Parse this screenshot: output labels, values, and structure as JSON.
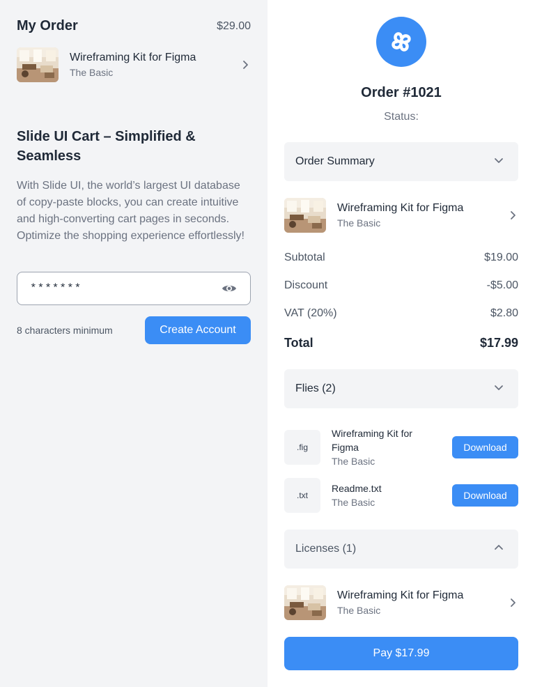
{
  "left": {
    "order_title": "My Order",
    "order_price": "$29.00",
    "product": {
      "name": "Wireframing Kit for Figma",
      "variant": "The Basic"
    },
    "promo_title": "Slide UI Cart – Simplified & Seamless",
    "promo_text": "With Slide UI, the world’s largest UI database of copy-paste blocks, you can create intuitive and high-converting cart pages in seconds. Optimize the shopping experience effortlessly!",
    "password_value": "*******",
    "password_hint": "8 characters minimum",
    "create_button": "Create Account"
  },
  "right": {
    "order_number": "Order #1021",
    "status_label": "Status:",
    "summary_title": "Order Summary",
    "summary_product": {
      "name": "Wireframing Kit for Figma",
      "variant": "The Basic"
    },
    "rows": [
      {
        "label": "Subtotal",
        "value": "$19.00"
      },
      {
        "label": "Discount",
        "value": "-$5.00"
      },
      {
        "label": "VAT (20%)",
        "value": "$2.80"
      }
    ],
    "total": {
      "label": "Total",
      "value": "$17.99"
    },
    "files_title": "Flies (2)",
    "files": [
      {
        "ext": ".fig",
        "name": "Wireframing Kit for Figma",
        "variant": "The Basic",
        "button": "Download"
      },
      {
        "ext": ".txt",
        "name": "Readme.txt",
        "variant": "The Basic",
        "button": "Download"
      }
    ],
    "licenses_title": "Licenses (1)",
    "license_product": {
      "name": "Wireframing Kit for Figma",
      "variant": "The Basic"
    },
    "pay_button": "Pay $17.99"
  },
  "icons": {
    "chevron_right": "chevron-right-icon",
    "chevron_down": "chevron-down-icon",
    "chevron_up": "chevron-up-icon",
    "eye": "eye-icon",
    "logo": "brand-logo-icon"
  },
  "colors": {
    "accent": "#3b8df5",
    "left_bg": "#f3f4f6",
    "text": "#1f2937",
    "muted": "#6b7280"
  }
}
